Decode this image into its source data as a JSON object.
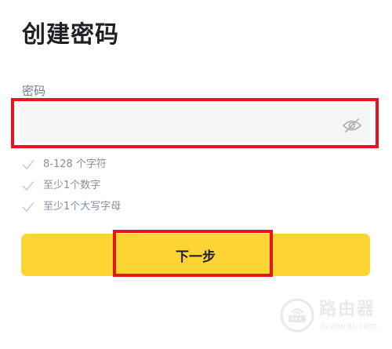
{
  "header": {
    "title": "创建密码"
  },
  "password_field": {
    "label": "密码",
    "value": "",
    "placeholder": "",
    "toggle_icon": "eye-off-icon"
  },
  "requirements": [
    {
      "text": "8-128 个字符",
      "met": false
    },
    {
      "text": "至少1个数字",
      "met": false
    },
    {
      "text": "至少1个大写字母",
      "met": false
    }
  ],
  "next_button": {
    "label": "下一步"
  },
  "watermark": {
    "title": "路由器",
    "url": "luyouqi.com"
  },
  "colors": {
    "primary": "#fcd535",
    "highlight": "#e8141f",
    "text_primary": "#1e2026",
    "text_secondary": "#848e9c",
    "input_bg": "#f5f5f5"
  }
}
